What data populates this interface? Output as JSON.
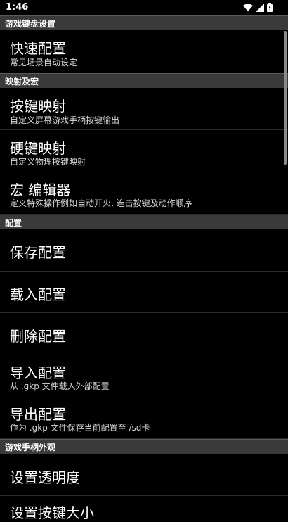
{
  "status_bar": {
    "time": "1:46",
    "icons": [
      "wifi-icon",
      "cell-signal-icon",
      "battery-icon"
    ]
  },
  "sections": [
    {
      "header": "游戏键盘设置"
    },
    {
      "header": "映射及宏"
    },
    {
      "header": "配置"
    },
    {
      "header": "游戏手柄外观"
    }
  ],
  "items": {
    "quick_config": {
      "title": "快速配置",
      "summary": "常见场景自动设定"
    },
    "key_mapping": {
      "title": "按键映射",
      "summary": "自定义屏幕游戏手柄按键输出"
    },
    "hw_key_mapping": {
      "title": "硬键映射",
      "summary": "自定义物理按键映射"
    },
    "macro_editor": {
      "title": "宏 编辑器",
      "summary": "定义特殊操作例如自动开火, 连击按键及动作顺序"
    },
    "save_config": {
      "title": "保存配置"
    },
    "load_config": {
      "title": "载入配置"
    },
    "delete_config": {
      "title": "删除配置"
    },
    "import_config": {
      "title": "导入配置",
      "summary": "从 .gkp 文件载入外部配置"
    },
    "export_config": {
      "title": "导出配置",
      "summary": "作为 .gkp 文件保存当前配置至 /sd卡"
    },
    "set_opacity": {
      "title": "设置透明度"
    },
    "set_key_size": {
      "title": "设置按键大小"
    }
  },
  "colors": {
    "background": "#000000",
    "section_header_bg": "#3a3a3a",
    "text_primary": "#ffffff",
    "text_secondary": "#d8d8d8"
  }
}
